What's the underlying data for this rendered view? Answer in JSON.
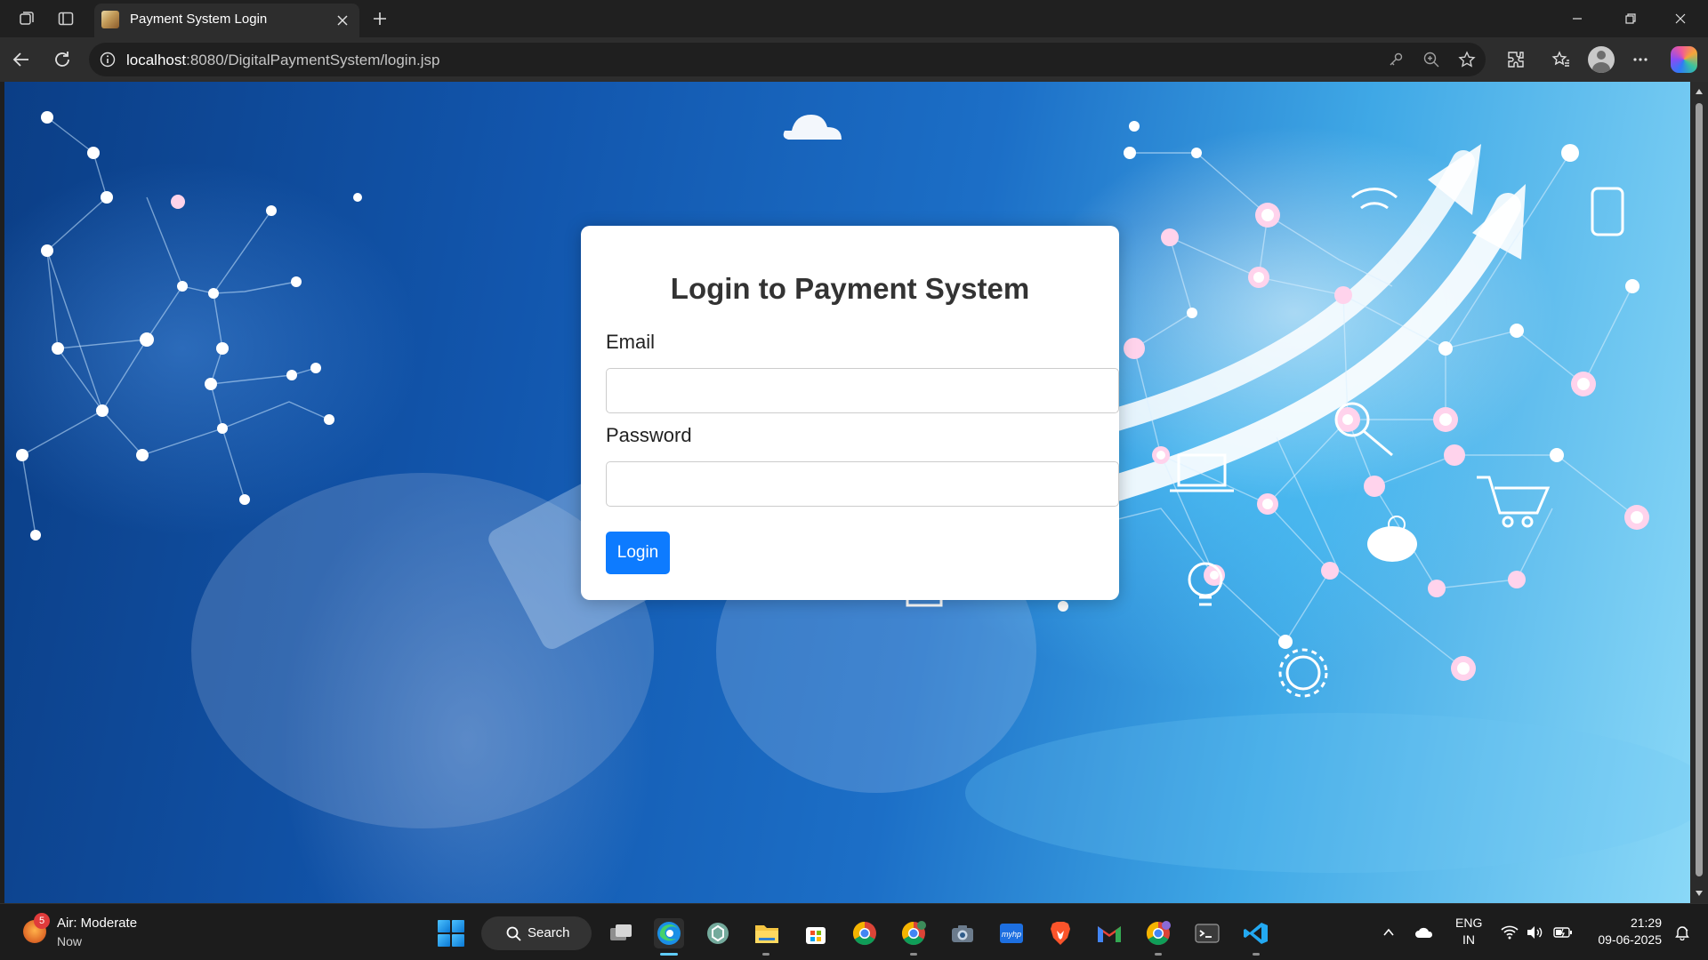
{
  "browser": {
    "tab_title": "Payment System Login",
    "url_host": "localhost",
    "url_rest": ":8080/DigitalPaymentSystem/login.jsp"
  },
  "login_form": {
    "title": "Login to Payment System",
    "email_label": "Email",
    "email_value": "",
    "password_label": "Password",
    "password_value": "",
    "login_button": "Login",
    "button_color": "#0d7bff"
  },
  "taskbar": {
    "weather": {
      "badge": "5",
      "title": "Air: Moderate",
      "subtitle": "Now"
    },
    "search_label": "Search",
    "apps": [
      "task-view",
      "edge",
      "chatgpt",
      "file-explorer",
      "microsoft-store",
      "chrome",
      "chrome-profile",
      "camera",
      "myhp",
      "brave",
      "gmail",
      "chrome-alt",
      "terminal",
      "vscode"
    ],
    "language": {
      "line1": "ENG",
      "line2": "IN"
    },
    "clock": {
      "time": "21:29",
      "date": "09-06-2025"
    }
  },
  "colors": {
    "chrome_dark": "#202020",
    "toolbar": "#2d2d2d",
    "accent": "#0d7bff"
  }
}
